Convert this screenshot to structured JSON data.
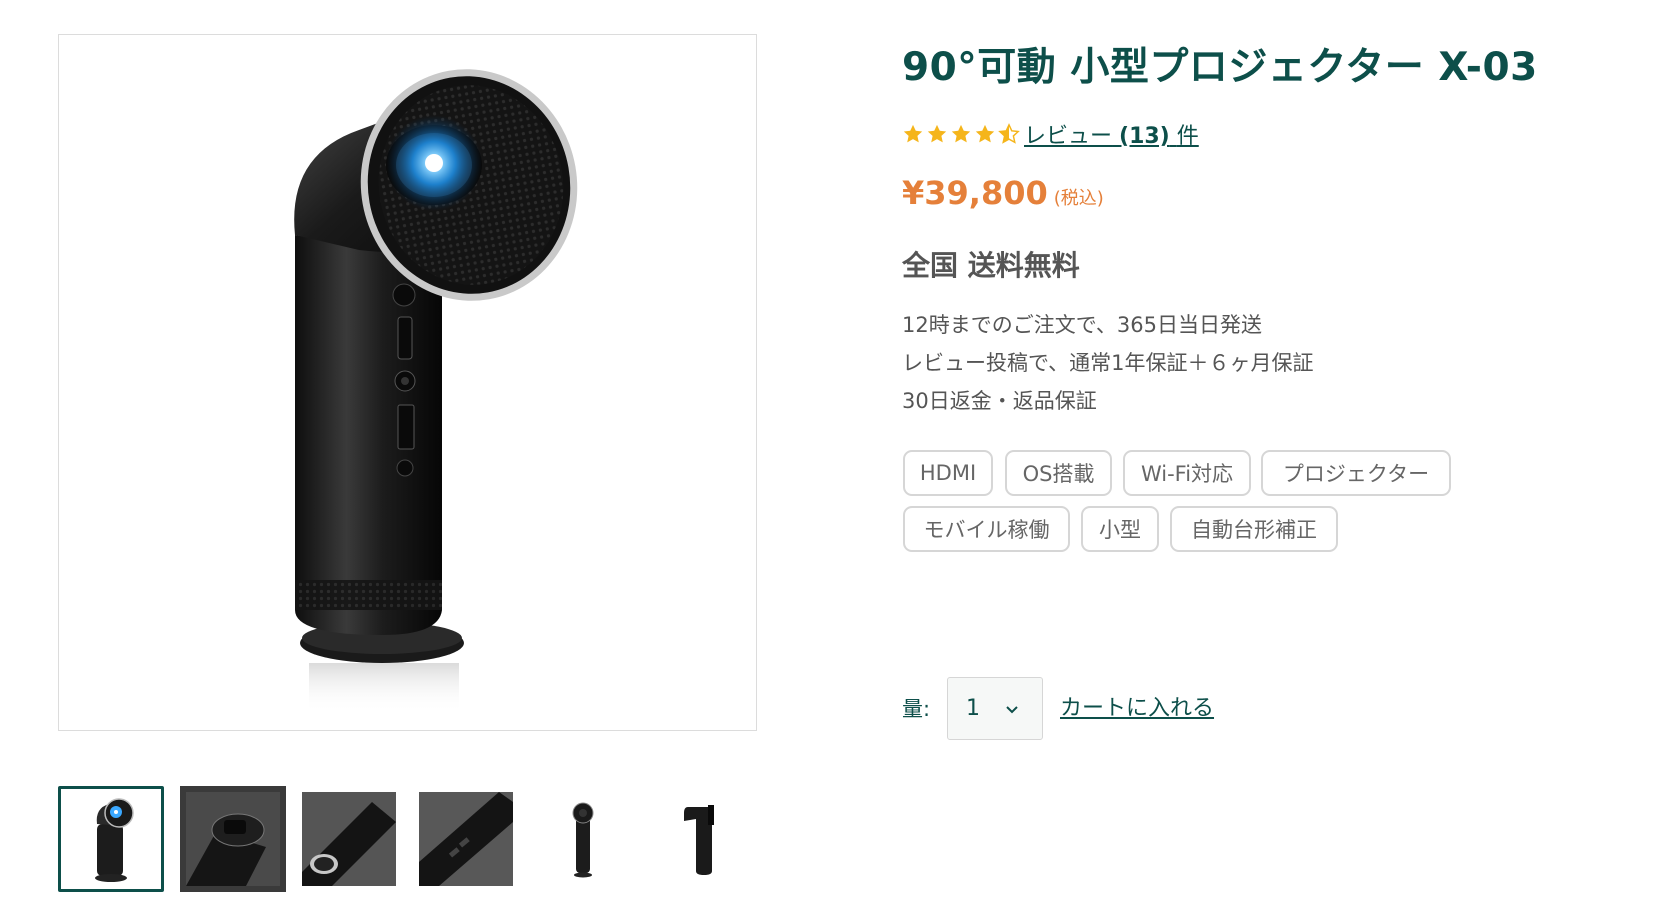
{
  "product": {
    "title": "90°可動 小型プロジェクター X-03",
    "rating": {
      "stars": 4.5,
      "star_color": "#f5b51b",
      "review_text": "レビュー",
      "review_count": "(13)",
      "review_suffix": "件"
    },
    "price": "¥39,800",
    "tax_note": "(税込)",
    "shipping": "全国 送料無料",
    "benefits": [
      "12時までのご注文で、365日当日発送",
      "レビュー投稿で、通常1年保証＋６ヶ月保証",
      "30日返金・返品保証"
    ],
    "tags": [
      "HDMI",
      "OS搭載",
      "Wi-Fi対応",
      "プロジェクター",
      "モバイル稼働",
      "小型",
      "自動台形補正"
    ]
  },
  "purchase": {
    "quantity_label": "量:",
    "quantity_value": "1",
    "add_to_cart_label": "カートに入れる"
  },
  "gallery": {
    "main_image": "projector-front-view",
    "thumbnails": [
      "projector-front-thumb",
      "projector-top-closeup-thumb",
      "projector-lens-angle-thumb",
      "projector-ports-angle-thumb",
      "projector-small-front-thumb",
      "projector-side-thumb"
    ],
    "active_thumbnail": 0
  },
  "colors": {
    "brand": "#0d4f4a",
    "price": "#e5803a",
    "tag_border": "#d6d6d6"
  }
}
